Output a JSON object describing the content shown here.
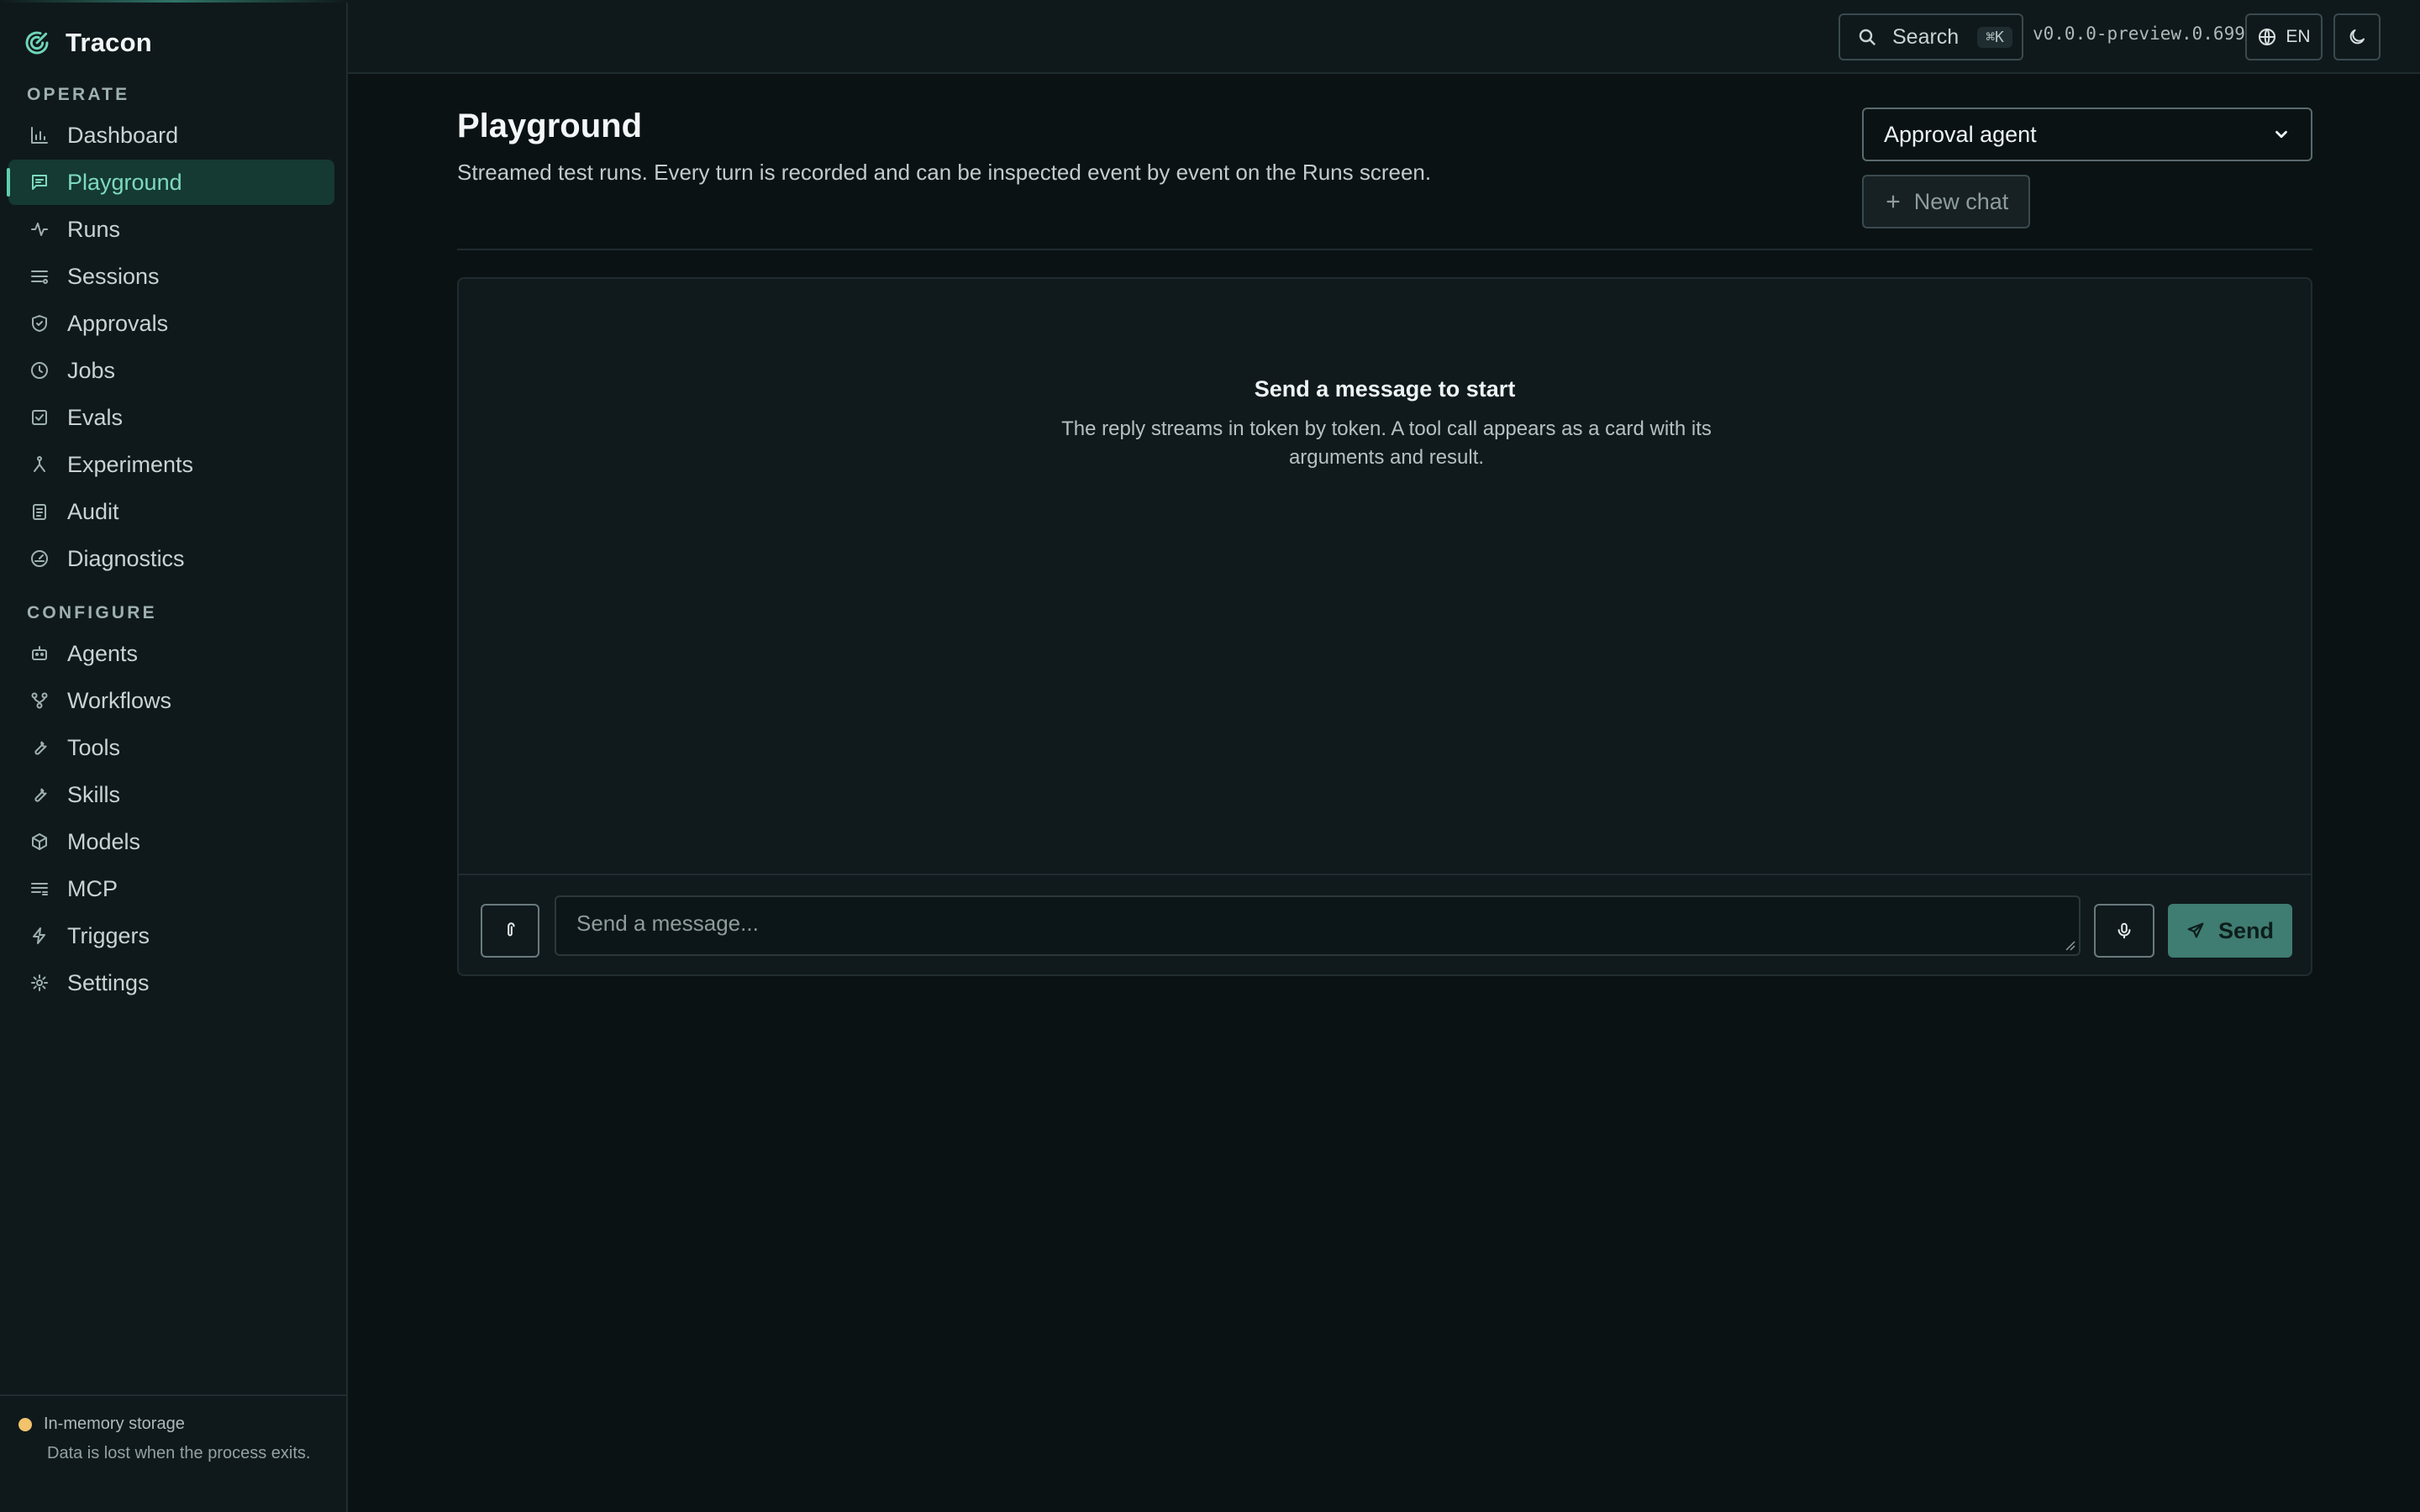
{
  "app": {
    "name": "Tracon"
  },
  "sidebar": {
    "operate_label": "OPERATE",
    "configure_label": "CONFIGURE",
    "operate_items": [
      {
        "label": "Dashboard",
        "icon": "bar-chart-icon"
      },
      {
        "label": "Playground",
        "icon": "chat-icon",
        "active": true
      },
      {
        "label": "Runs",
        "icon": "activity-icon"
      },
      {
        "label": "Sessions",
        "icon": "list-icon"
      },
      {
        "label": "Approvals",
        "icon": "shield-check-icon"
      },
      {
        "label": "Jobs",
        "icon": "clock-icon"
      },
      {
        "label": "Evals",
        "icon": "check-square-icon"
      },
      {
        "label": "Experiments",
        "icon": "branch-icon"
      },
      {
        "label": "Audit",
        "icon": "clipboard-icon"
      },
      {
        "label": "Diagnostics",
        "icon": "gauge-icon"
      }
    ],
    "configure_items": [
      {
        "label": "Agents",
        "icon": "bot-icon"
      },
      {
        "label": "Workflows",
        "icon": "workflow-icon"
      },
      {
        "label": "Tools",
        "icon": "wrench-icon"
      },
      {
        "label": "Skills",
        "icon": "wrench-icon"
      },
      {
        "label": "Models",
        "icon": "cube-icon"
      },
      {
        "label": "MCP",
        "icon": "server-list-icon"
      },
      {
        "label": "Triggers",
        "icon": "zap-icon"
      },
      {
        "label": "Settings",
        "icon": "gear-icon"
      }
    ],
    "footer": {
      "title": "In-memory storage",
      "description": "Data is lost when the process exits.",
      "dot_color": "#f2c36b"
    }
  },
  "topbar": {
    "search_label": "Search",
    "search_shortcut": "⌘K",
    "version": "v0.0.0-preview.0.699",
    "language": "EN"
  },
  "main": {
    "title": "Playground",
    "subtitle": "Streamed test runs. Every turn is recorded and can be inspected event by event on the Runs screen.",
    "agent_select_value": "Approval agent",
    "new_chat_label": "New chat",
    "empty_title": "Send a message to start",
    "empty_description": "The reply streams in token by token. A tool call appears as a card with its arguments and result.",
    "composer": {
      "placeholder": "Send a message...",
      "send_label": "Send"
    }
  },
  "colors": {
    "accent": "#5fcfae",
    "send_button": "#3f7c71",
    "background": "#0a1214"
  }
}
